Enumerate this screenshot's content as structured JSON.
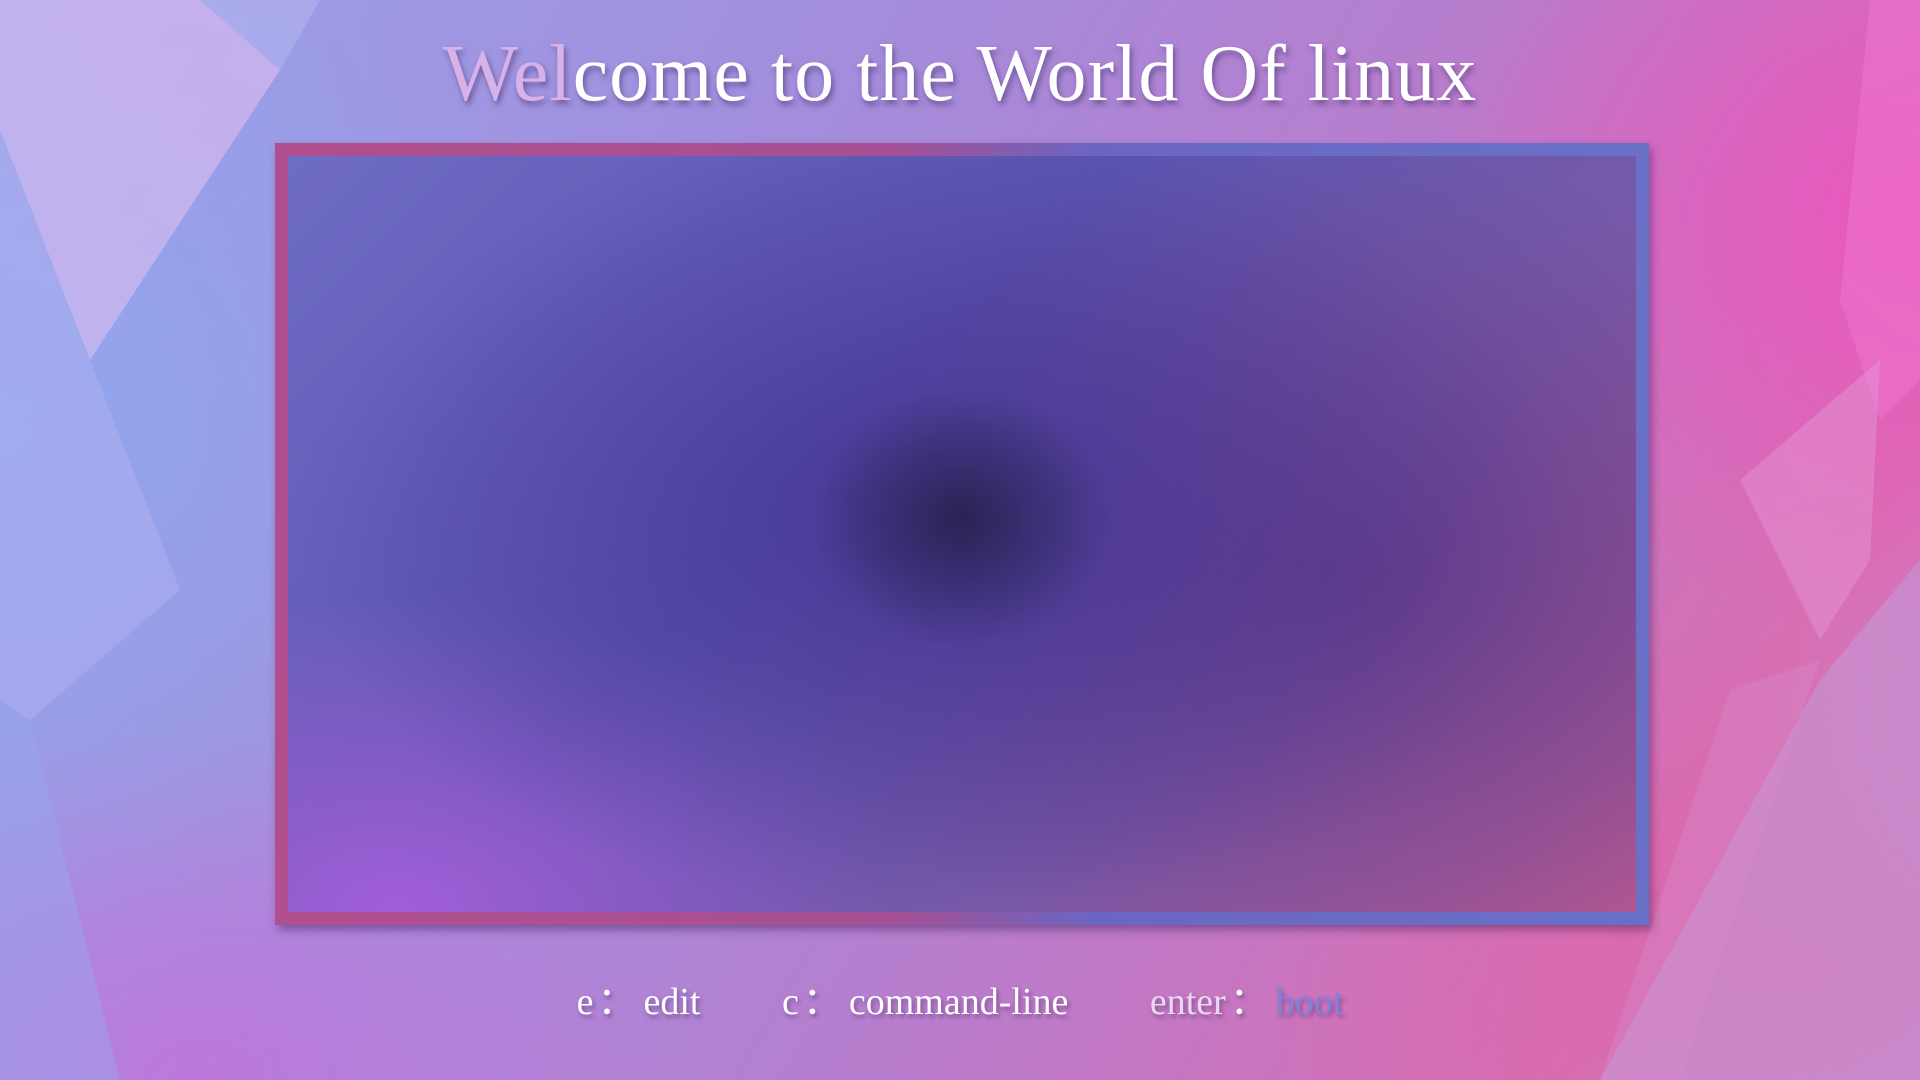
{
  "title": {
    "lead": "Wel",
    "rest": "come to the World Of linux"
  },
  "hints": [
    {
      "key": "e",
      "separator": "：",
      "action": "edit"
    },
    {
      "key": "c",
      "separator": "：",
      "action": "command-line"
    },
    {
      "key": "enter",
      "separator": "：",
      "action": "boot"
    }
  ],
  "colors": {
    "title_text": "#ffffff",
    "title_lead": "#d7b2e8",
    "selected_action": "#7e82d8",
    "panel_border_left": "#b14f8e",
    "panel_border_right": "#6a70c6"
  }
}
